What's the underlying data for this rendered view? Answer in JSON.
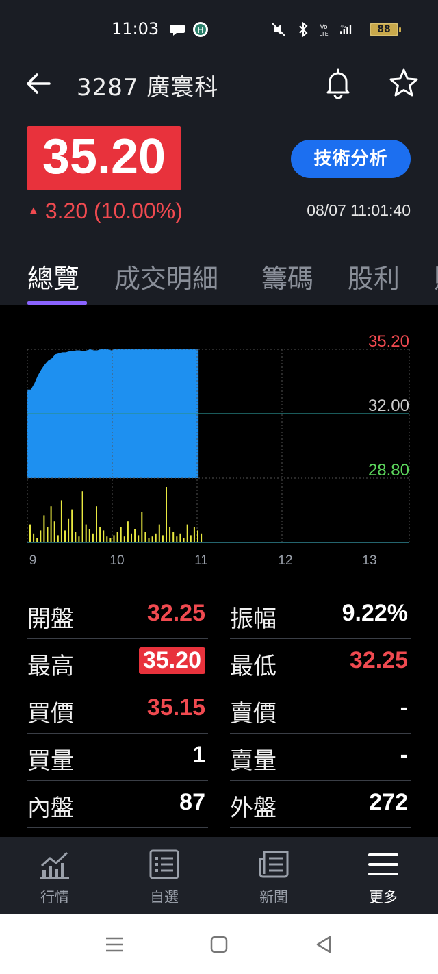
{
  "status_bar": {
    "time": "11:03",
    "battery": "88"
  },
  "header": {
    "title": "3287 廣寰科"
  },
  "quote": {
    "price": "35.20",
    "change_arrow": "▲",
    "change": "3.20 (10.00%)",
    "tech_button": "技術分析",
    "timestamp": "08/07 11:01:40"
  },
  "tabs": [
    {
      "label": "總覽",
      "active": true
    },
    {
      "label": "成交明細"
    },
    {
      "label": "籌碼"
    },
    {
      "label": "股利"
    },
    {
      "label": "財"
    }
  ],
  "chart_data": {
    "type": "area",
    "y_labels": {
      "high": "35.20",
      "ref": "32.00",
      "low": "28.80"
    },
    "ylim": [
      28.8,
      35.2
    ],
    "reference": 32.0,
    "x_ticks": [
      "9",
      "10",
      "11",
      "12",
      "13"
    ],
    "colors": {
      "area": "#1e90f0",
      "volume": "#e8e840",
      "high": "#f04a50",
      "ref": "#cccccc",
      "low": "#5cd65c"
    },
    "price_series": [
      33.2,
      33.2,
      33.5,
      33.9,
      34.2,
      34.45,
      34.65,
      34.75,
      34.95,
      35.0,
      35.05,
      35.05,
      35.1,
      35.1,
      35.15,
      35.15,
      35.1,
      35.15,
      35.2,
      35.15,
      35.15,
      35.2,
      35.2,
      35.2,
      35.15,
      35.2,
      35.2,
      35.2,
      35.2,
      35.2,
      35.2,
      35.2,
      35.2,
      35.2,
      35.2,
      35.2,
      35.2,
      35.2,
      35.2,
      35.2,
      35.2,
      35.2,
      35.2,
      35.2,
      35.2,
      35.2,
      35.2,
      35.2,
      35.2,
      35.2
    ],
    "volume_series": [
      30,
      15,
      8,
      20,
      45,
      25,
      60,
      35,
      12,
      70,
      20,
      40,
      55,
      18,
      10,
      85,
      30,
      22,
      15,
      60,
      25,
      20,
      10,
      8,
      12,
      18,
      25,
      10,
      35,
      15,
      22,
      12,
      50,
      18,
      8,
      10,
      15,
      30,
      12,
      92,
      25,
      18,
      10,
      15,
      8,
      30,
      12,
      25,
      20,
      15
    ]
  },
  "stats": {
    "left": [
      {
        "label": "開盤",
        "value": "32.25",
        "color": "red"
      },
      {
        "label": "最高",
        "value": "35.20",
        "color": "boxed"
      },
      {
        "label": "買價",
        "value": "35.15",
        "color": "red"
      },
      {
        "label": "買量",
        "value": "1",
        "color": "white"
      },
      {
        "label": "內盤",
        "value": "87",
        "color": "white"
      }
    ],
    "right": [
      {
        "label": "振幅",
        "value": "9.22%",
        "color": "white"
      },
      {
        "label": "最低",
        "value": "32.25",
        "color": "red"
      },
      {
        "label": "賣價",
        "value": "-",
        "color": "white"
      },
      {
        "label": "賣量",
        "value": "-",
        "color": "white"
      },
      {
        "label": "外盤",
        "value": "272",
        "color": "white"
      }
    ]
  },
  "bottom_nav": [
    {
      "label": "行情",
      "icon": "market-chart-icon"
    },
    {
      "label": "自選",
      "icon": "watchlist-icon"
    },
    {
      "label": "新聞",
      "icon": "news-icon"
    },
    {
      "label": "更多",
      "icon": "menu-icon",
      "active": true
    }
  ]
}
